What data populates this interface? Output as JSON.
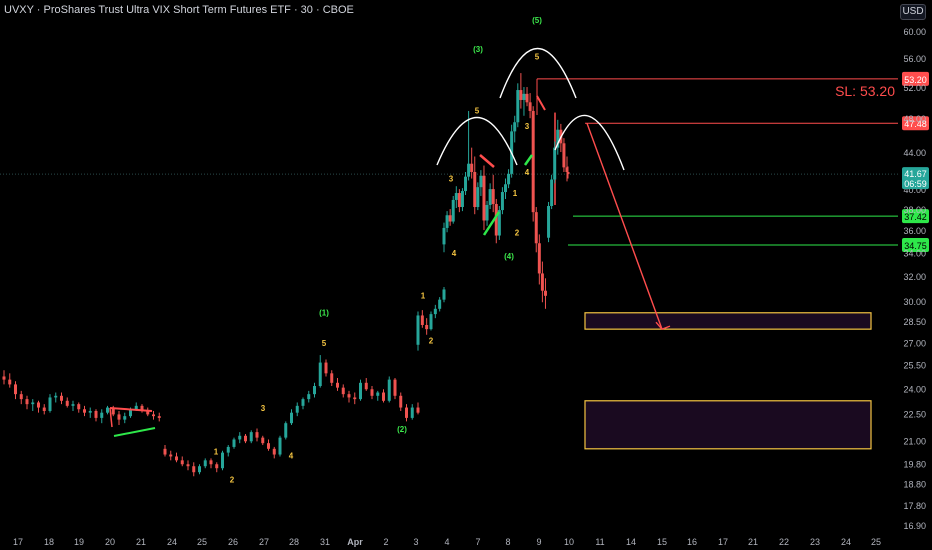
{
  "title": "UVXY · ProShares Trust Ultra VIX Short Term Futures ETF · 30 · CBOE",
  "currency_button": "USD",
  "sl_label": "SL: 53.20",
  "colors": {
    "bull": "#26a69a",
    "bear": "#ef5350",
    "wave_count": "#f5c542",
    "wave_degree": "#3ce84c",
    "resistance": "#ff4d4d",
    "support": "#2ee84a",
    "zone_border": "#f5c542",
    "zone_fill": "#1a0a20",
    "arc": "#ffffff",
    "last_price": "#26a69a"
  },
  "chart_data": {
    "type": "candlestick",
    "title": "UVXY · ProShares Trust Ultra VIX Short Term Futures ETF · 30 · CBOE",
    "y_scale": "log",
    "ylim": [
      16.5,
      63
    ],
    "y_ticks": [
      60.0,
      56.0,
      52.0,
      48.0,
      44.0,
      40.0,
      38.0,
      36.0,
      34.0,
      32.0,
      30.0,
      28.5,
      27.0,
      25.5,
      24.0,
      22.5,
      21.0,
      19.8,
      18.8,
      17.8,
      16.9
    ],
    "y_tick_labels": [
      "60.00",
      "56.00",
      "52.00",
      "48.00",
      "44.00",
      "40.00",
      "38.00",
      "36.00",
      "34.00",
      "32.00",
      "30.00",
      "28.50",
      "27.00",
      "25.50",
      "24.00",
      "22.50",
      "21.00",
      "19.80",
      "18.80",
      "17.80",
      "16.90"
    ],
    "x_categories": [
      "17",
      "18",
      "19",
      "20",
      "21",
      "24",
      "25",
      "26",
      "27",
      "28",
      "31",
      "Apr",
      "2",
      "3",
      "4",
      "7",
      "8",
      "9",
      "10",
      "11",
      "14",
      "15",
      "16",
      "17",
      "21",
      "22",
      "23",
      "24",
      "25"
    ],
    "x_tick_labels": [
      "17",
      "18",
      "19",
      "20",
      "21",
      "24",
      "25",
      "26",
      "27",
      "28",
      "31",
      "Apr",
      "2",
      "3",
      "4",
      "7",
      "8",
      "9",
      "10",
      "11",
      "14",
      "15",
      "16",
      "17",
      "21",
      "22",
      "23",
      "24",
      "25"
    ],
    "last_price": {
      "value": 41.67,
      "countdown": "06:59"
    },
    "price_levels": [
      {
        "value": 53.2,
        "label": "53.20",
        "role": "resistance"
      },
      {
        "value": 47.48,
        "label": "47.48",
        "role": "resistance"
      },
      {
        "value": 37.42,
        "label": "37.42",
        "role": "support"
      },
      {
        "value": 34.75,
        "label": "34.75",
        "role": "support"
      }
    ],
    "zones": [
      {
        "x_from": "10.5",
        "x_to": "20",
        "y_from": 28.0,
        "y_to": 29.2
      },
      {
        "x_from": "10.5",
        "x_to": "20",
        "y_from": 20.6,
        "y_to": 23.3
      }
    ],
    "projection": {
      "from": {
        "x": "10.6",
        "y": 47.48
      },
      "to": {
        "x": "14.9",
        "y": 28.0
      }
    },
    "wave_labels": [
      {
        "text": "1",
        "x": "25",
        "y": 20.3,
        "style": "count"
      },
      {
        "text": "2",
        "x": "25.5",
        "y": 18.9,
        "style": "count"
      },
      {
        "text": "3",
        "x": "27",
        "y": 22.7,
        "style": "count"
      },
      {
        "text": "4",
        "x": "28",
        "y": 20.1,
        "style": "count"
      },
      {
        "text": "5",
        "x": "31",
        "y": 26.8,
        "style": "count"
      },
      {
        "text": "(1)",
        "x": "31",
        "y": 29.0,
        "style": "degree"
      },
      {
        "text": "(2)",
        "x": "2.5",
        "y": 21.5,
        "style": "degree"
      },
      {
        "text": "1",
        "x": "3.5",
        "y": 30.3,
        "style": "count"
      },
      {
        "text": "2",
        "x": "4",
        "y": 27.0,
        "style": "count"
      },
      {
        "text": "3",
        "x": "4.5",
        "y": 40.9,
        "style": "count"
      },
      {
        "text": "4",
        "x": "4.7",
        "y": 33.8,
        "style": "count"
      },
      {
        "text": "5",
        "x": "7",
        "y": 48.7,
        "style": "count"
      },
      {
        "text": "(3)",
        "x": "7",
        "y": 57.0,
        "style": "degree"
      },
      {
        "text": "1",
        "x": "8.2",
        "y": 39.4,
        "style": "count"
      },
      {
        "text": "2",
        "x": "8.3",
        "y": 35.6,
        "style": "count"
      },
      {
        "text": "(4)",
        "x": "8",
        "y": 33.5,
        "style": "degree"
      },
      {
        "text": "3",
        "x": "8.5",
        "y": 46.8,
        "style": "count"
      },
      {
        "text": "4",
        "x": "8.5",
        "y": 41.6,
        "style": "count"
      },
      {
        "text": "5",
        "x": "9",
        "y": 55.9,
        "style": "count"
      },
      {
        "text": "(5)",
        "x": "9",
        "y": 61.4,
        "style": "degree"
      }
    ],
    "arcs": [
      {
        "center_x": "7",
        "peak_y": 49.0,
        "label": "left shoulder"
      },
      {
        "center_x": "9",
        "peak_y": 60.0,
        "label": "head"
      },
      {
        "center_x": "10.7",
        "peak_y": 49.5,
        "label": "right shoulder"
      }
    ],
    "candles": [
      [
        24.8,
        25.2,
        24.3,
        24.6
      ],
      [
        24.6,
        25.0,
        24.1,
        24.3
      ],
      [
        24.3,
        24.5,
        23.4,
        23.7
      ],
      [
        23.7,
        23.9,
        23.1,
        23.4
      ],
      [
        23.4,
        23.6,
        22.8,
        23.1
      ],
      [
        23.1,
        23.4,
        22.7,
        23.2
      ],
      [
        23.2,
        23.3,
        22.6,
        22.9
      ],
      [
        22.9,
        23.1,
        22.5,
        22.7
      ],
      [
        22.7,
        23.7,
        22.6,
        23.5
      ],
      [
        23.5,
        23.8,
        23.2,
        23.6
      ],
      [
        23.6,
        23.8,
        23.1,
        23.3
      ],
      [
        23.3,
        23.5,
        22.9,
        23.0
      ],
      [
        23.0,
        23.3,
        22.7,
        23.1
      ],
      [
        23.1,
        23.2,
        22.6,
        22.8
      ],
      [
        22.8,
        23.0,
        22.4,
        22.6
      ],
      [
        22.6,
        22.9,
        22.3,
        22.7
      ],
      [
        22.7,
        22.8,
        22.1,
        22.3
      ],
      [
        22.3,
        22.8,
        22.0,
        22.6
      ],
      [
        22.6,
        23.0,
        22.5,
        22.9
      ],
      [
        22.9,
        23.0,
        22.4,
        22.5
      ],
      [
        22.5,
        22.7,
        21.9,
        22.2
      ],
      [
        22.2,
        22.6,
        22.0,
        22.4
      ],
      [
        22.4,
        22.9,
        22.3,
        22.8
      ],
      [
        22.8,
        23.2,
        22.7,
        23.0
      ],
      [
        23.0,
        23.1,
        22.6,
        22.7
      ],
      [
        22.7,
        22.9,
        22.4,
        22.5
      ],
      [
        22.5,
        22.7,
        22.2,
        22.4
      ],
      [
        22.4,
        22.6,
        22.1,
        22.3
      ],
      [
        20.6,
        20.8,
        20.2,
        20.3
      ],
      [
        20.3,
        20.5,
        20.0,
        20.2
      ],
      [
        20.2,
        20.4,
        19.9,
        20.0
      ],
      [
        20.0,
        20.2,
        19.7,
        19.8
      ],
      [
        19.8,
        20.0,
        19.5,
        19.7
      ],
      [
        19.7,
        19.9,
        19.2,
        19.4
      ],
      [
        19.4,
        19.8,
        19.3,
        19.7
      ],
      [
        19.7,
        20.1,
        19.6,
        20.0
      ],
      [
        20.0,
        20.1,
        19.6,
        19.8
      ],
      [
        19.8,
        19.9,
        19.4,
        19.6
      ],
      [
        19.6,
        20.5,
        19.5,
        20.4
      ],
      [
        20.4,
        20.8,
        20.2,
        20.7
      ],
      [
        20.7,
        21.2,
        20.6,
        21.1
      ],
      [
        21.1,
        21.5,
        20.9,
        21.3
      ],
      [
        21.3,
        21.4,
        20.9,
        21.0
      ],
      [
        21.0,
        21.6,
        20.9,
        21.5
      ],
      [
        21.5,
        21.7,
        21.0,
        21.2
      ],
      [
        21.2,
        21.3,
        20.8,
        20.9
      ],
      [
        20.9,
        21.1,
        20.5,
        20.6
      ],
      [
        20.6,
        20.7,
        20.1,
        20.3
      ],
      [
        20.3,
        21.3,
        20.2,
        21.2
      ],
      [
        21.2,
        22.1,
        21.1,
        22.0
      ],
      [
        22.0,
        22.8,
        21.9,
        22.6
      ],
      [
        22.6,
        23.2,
        22.4,
        23.0
      ],
      [
        23.0,
        23.5,
        22.8,
        23.4
      ],
      [
        23.4,
        23.9,
        23.2,
        23.7
      ],
      [
        23.7,
        24.4,
        23.5,
        24.2
      ],
      [
        24.2,
        26.2,
        24.1,
        25.7
      ],
      [
        25.7,
        25.9,
        24.8,
        25.0
      ],
      [
        25.0,
        25.2,
        24.2,
        24.4
      ],
      [
        24.4,
        24.7,
        23.9,
        24.1
      ],
      [
        24.1,
        24.3,
        23.5,
        23.7
      ],
      [
        23.7,
        23.9,
        23.2,
        23.5
      ],
      [
        23.5,
        23.8,
        23.1,
        23.4
      ],
      [
        23.4,
        24.6,
        23.3,
        24.4
      ],
      [
        24.4,
        24.7,
        23.9,
        24.0
      ],
      [
        24.0,
        24.2,
        23.4,
        23.6
      ],
      [
        23.6,
        23.9,
        23.3,
        23.8
      ],
      [
        23.8,
        24.0,
        23.2,
        23.3
      ],
      [
        23.3,
        24.8,
        23.2,
        24.6
      ],
      [
        24.6,
        24.7,
        23.4,
        23.6
      ],
      [
        23.6,
        23.8,
        22.7,
        22.9
      ],
      [
        22.9,
        23.1,
        22.1,
        22.3
      ],
      [
        22.3,
        23.1,
        22.2,
        22.9
      ],
      [
        22.9,
        23.2,
        22.5,
        22.6
      ],
      [
        26.9,
        29.3,
        26.5,
        29.0
      ],
      [
        29.0,
        29.4,
        28.1,
        28.3
      ],
      [
        28.3,
        28.8,
        27.6,
        28.0
      ],
      [
        28.0,
        29.3,
        27.9,
        29.1
      ],
      [
        29.1,
        29.8,
        28.8,
        29.5
      ],
      [
        29.5,
        30.4,
        29.3,
        30.2
      ],
      [
        30.2,
        31.2,
        30.0,
        31.0
      ],
      [
        34.8,
        36.8,
        34.1,
        36.3
      ],
      [
        36.3,
        37.9,
        35.9,
        37.5
      ],
      [
        37.5,
        38.1,
        36.5,
        36.9
      ],
      [
        36.9,
        39.4,
        36.7,
        39.0
      ],
      [
        39.0,
        40.4,
        38.2,
        39.7
      ],
      [
        39.7,
        40.1,
        37.8,
        38.3
      ],
      [
        38.3,
        40.2,
        37.9,
        39.9
      ],
      [
        39.9,
        41.9,
        39.5,
        41.4
      ],
      [
        41.4,
        49.0,
        41.0,
        42.8
      ],
      [
        42.8,
        44.6,
        41.2,
        41.9
      ],
      [
        41.9,
        43.6,
        37.6,
        38.3
      ],
      [
        38.3,
        40.8,
        38.0,
        40.3
      ],
      [
        40.3,
        42.1,
        39.4,
        41.5
      ],
      [
        41.5,
        42.6,
        36.1,
        37.0
      ],
      [
        37.0,
        38.9,
        36.5,
        38.5
      ],
      [
        38.5,
        40.7,
        38.1,
        40.1
      ],
      [
        40.1,
        41.6,
        37.8,
        38.6
      ],
      [
        38.6,
        39.1,
        34.9,
        35.6
      ],
      [
        35.6,
        38.4,
        35.2,
        38.0
      ],
      [
        38.0,
        40.3,
        37.6,
        39.8
      ],
      [
        39.8,
        41.2,
        39.1,
        40.6
      ],
      [
        40.6,
        42.2,
        40.2,
        41.7
      ],
      [
        41.7,
        47.3,
        41.3,
        46.5
      ],
      [
        46.5,
        48.4,
        45.2,
        47.6
      ],
      [
        47.6,
        52.6,
        47.0,
        51.7
      ],
      [
        51.7,
        54.0,
        49.3,
        50.4
      ],
      [
        50.4,
        52.1,
        48.4,
        51.2
      ],
      [
        51.2,
        52.1,
        49.6,
        50.1
      ],
      [
        50.1,
        51.3,
        48.1,
        49.0
      ],
      [
        49.0,
        49.6,
        36.9,
        37.8
      ],
      [
        37.8,
        38.3,
        34.1,
        34.9
      ],
      [
        34.9,
        35.7,
        31.4,
        32.3
      ],
      [
        32.3,
        33.3,
        30.0,
        30.9
      ],
      [
        30.9,
        31.9,
        29.5,
        30.5
      ],
      [
        35.4,
        38.8,
        35.0,
        38.4
      ],
      [
        38.4,
        41.6,
        38.1,
        41.1
      ],
      [
        41.1,
        45.3,
        40.7,
        44.6
      ],
      [
        44.6,
        47.9,
        43.8,
        46.7
      ],
      [
        46.7,
        47.4,
        44.1,
        45.1
      ],
      [
        45.1,
        45.7,
        41.9,
        42.4
      ],
      [
        42.4,
        43.6,
        40.9,
        41.9
      ],
      [
        41.9,
        42.5,
        41.2,
        41.67
      ]
    ]
  }
}
